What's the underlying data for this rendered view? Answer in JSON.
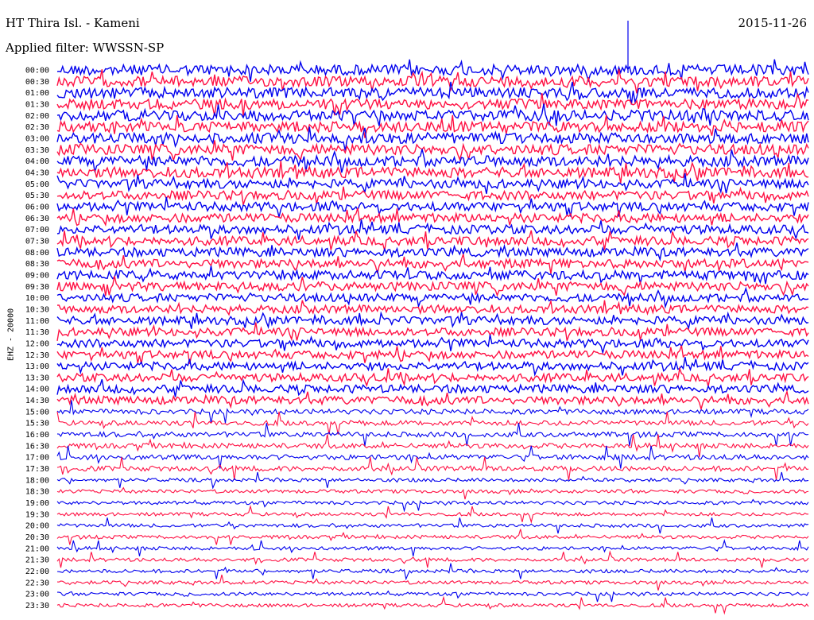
{
  "header": {
    "station": "HT Thira Isl. - Kameni",
    "date": "2015-11-26",
    "filter": "Applied filter: WWSSN-SP"
  },
  "chart_data": {
    "type": "line",
    "ylabel": "EHZ - 20000",
    "row_labels": [
      "00:00",
      "00:30",
      "01:00",
      "01:30",
      "02:00",
      "02:30",
      "03:00",
      "03:30",
      "04:00",
      "04:30",
      "05:00",
      "05:30",
      "06:00",
      "06:30",
      "07:00",
      "07:30",
      "08:00",
      "08:30",
      "09:00",
      "09:30",
      "10:00",
      "10:30",
      "11:00",
      "11:30",
      "12:00",
      "12:30",
      "13:00",
      "13:30",
      "14:00",
      "14:30",
      "15:00",
      "15:30",
      "16:00",
      "16:30",
      "17:00",
      "17:30",
      "18:00",
      "18:30",
      "19:00",
      "19:30",
      "20:00",
      "20:30",
      "21:00",
      "21:30",
      "22:00",
      "22:30",
      "23:00",
      "23:30"
    ],
    "series_colors": [
      "#0000ee",
      "#ff1144"
    ],
    "grid": false
  }
}
